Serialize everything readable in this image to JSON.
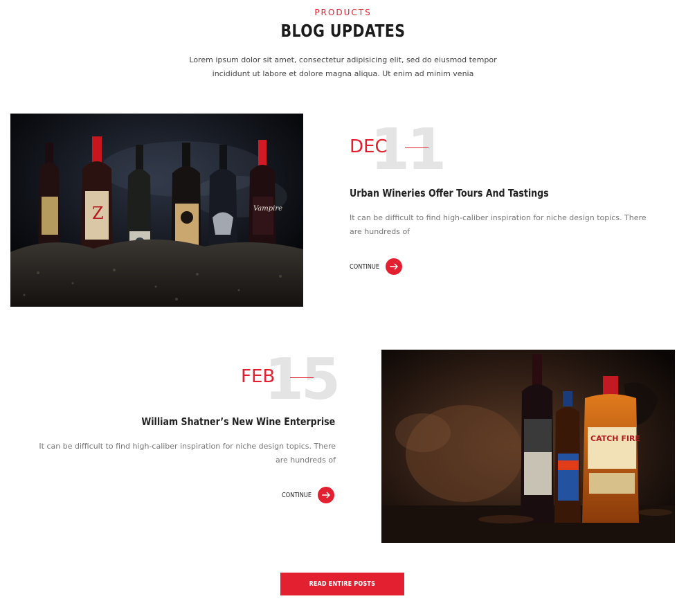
{
  "section": {
    "eyebrow": "PRODUCTS",
    "title": "BLOG UPDATES",
    "intro": "Lorem ipsum dolor sit amet, consectetur adipisicing elit, sed do eiusmod tempor incididunt ut labore et dolore magna aliqua. Ut enim ad minim venia"
  },
  "posts": [
    {
      "day": "11",
      "month": "DEC",
      "title": "Urban Wineries Offer Tours And Tastings",
      "excerpt": "It can be difficult to find high-caliber inspiration for niche design topics. There are hundreds of",
      "continue_label": "CONTINUE"
    },
    {
      "day": "15",
      "month": "FEB",
      "title": "William Shatner’s New Wine Enterprise",
      "excerpt": "It can be difficult to find high-caliber inspiration for niche design topics. There are hundreds of",
      "continue_label": "CONTINUE"
    }
  ],
  "footer": {
    "button_label": "READ ENTIRE POSTS"
  },
  "colors": {
    "accent": "#e3202f",
    "date_number": "#e4e4e4",
    "heading": "#1b1b1b",
    "body_text": "#777777"
  },
  "icons": {
    "continue": "arrow-right-icon"
  }
}
